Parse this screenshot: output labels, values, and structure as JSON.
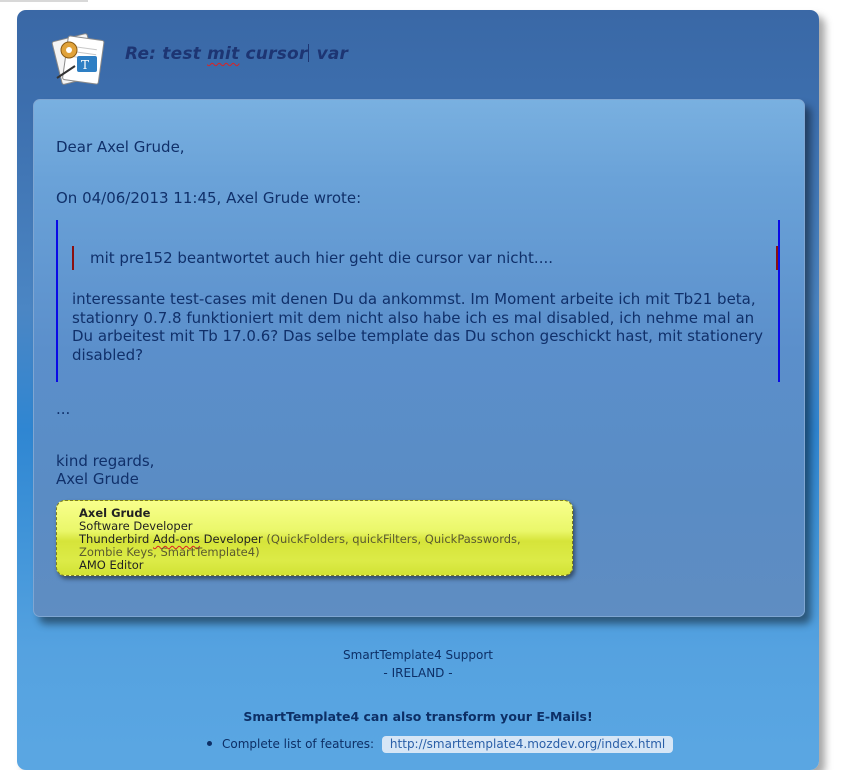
{
  "header": {
    "subject_prefix": "Re: test ",
    "subject_misspelled": "mit",
    "subject_middle": " cursor",
    "subject_suffix": " var",
    "logo_icon": "smarttemplate-logo-icon"
  },
  "message": {
    "greeting": "Dear Axel Grude,",
    "attribution": "On 04/06/2013 11:45, Axel Grude wrote:",
    "inner_quote": "mit pre152 beantwortet auch hier geht die cursor var nicht....",
    "quote_paragraph": "interessante test-cases mit denen Du da ankommst. Im Moment arbeite ich mit Tb21 beta, stationry 0.7.8 funktioniert mit dem nicht also habe ich es mal disabled, ich nehme mal an Du arbeitest mit Tb 17.0.6? Das selbe template das Du schon geschickt hast, mit stationery disabled?",
    "ellipsis": "...",
    "closing": "kind regards,",
    "signer": "Axel Grude"
  },
  "signature": {
    "name": "Axel Grude",
    "title": "Software Developer",
    "role_prefix": "Thunderbird ",
    "role_misspelled": "Add-ons",
    "role_suffix": " Developer ",
    "addons": "(QuickFolders, quickFilters, QuickPasswords, Zombie Keys, SmartTemplate4)",
    "extra_role": "AMO Editor"
  },
  "footer": {
    "support": "SmartTemplate4 Support",
    "country": "- IRELAND -",
    "promo": "SmartTemplate4 can also transform your E-Mails!",
    "features_label": "Complete list of features:",
    "features_link": "http://smarttemplate4.mozdev.org/index.html"
  },
  "colors": {
    "accent_text": "#10306a",
    "quote_border": "#0a0ae6",
    "inner_quote_border": "#8a1010",
    "signature_bg": "#e4f050"
  }
}
